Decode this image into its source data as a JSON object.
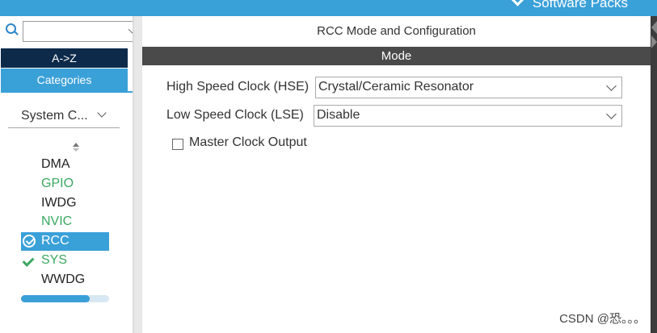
{
  "header": {
    "software_packs_label": "Software Packs"
  },
  "left_panel": {
    "search": {
      "value": "",
      "placeholder": ""
    },
    "sort_az_label": "A->Z",
    "categories_label": "Categories",
    "category_dropdown": "System C...",
    "items": [
      {
        "label": "DMA",
        "state": "normal"
      },
      {
        "label": "GPIO",
        "state": "configured"
      },
      {
        "label": "IWDG",
        "state": "normal"
      },
      {
        "label": "NVIC",
        "state": "configured"
      },
      {
        "label": "RCC",
        "state": "selected-checked"
      },
      {
        "label": "SYS",
        "state": "checked"
      },
      {
        "label": "WWDG",
        "state": "normal"
      }
    ],
    "scroll_position": 0.78
  },
  "main": {
    "title": "RCC Mode and Configuration",
    "section_label": "Mode",
    "fields": {
      "hse_label": "High Speed Clock (HSE)",
      "hse_value": "Crystal/Ceramic Resonator",
      "lse_label": "Low Speed Clock (LSE)",
      "lse_value": "Disable",
      "mco_label": "Master Clock Output",
      "mco_checked": false
    }
  },
  "watermark": "CSDN @恐。。。",
  "colors": {
    "accent": "#3aa0d8",
    "configured": "#3aa860",
    "dark_header": "#0d2a4a",
    "mode_bar": "#4a4a4a"
  }
}
